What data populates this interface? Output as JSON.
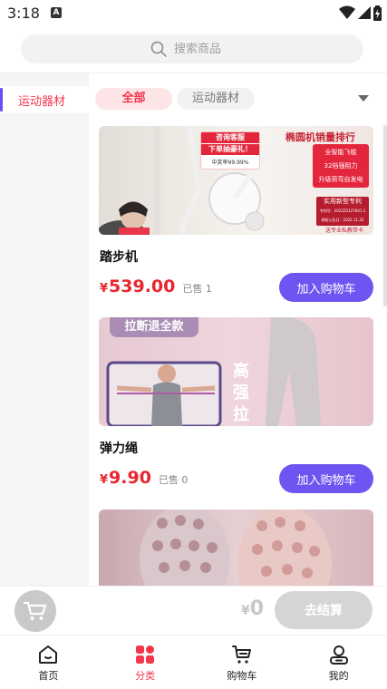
{
  "status_bar": {
    "time": "3:18",
    "notification": "A"
  },
  "search": {
    "placeholder": "搜索商品"
  },
  "sidebar": {
    "items": [
      {
        "label": "运动器材"
      }
    ]
  },
  "filters": {
    "chips": [
      {
        "label": "全部"
      },
      {
        "label": "运动器材"
      }
    ]
  },
  "products": [
    {
      "name": "踏步机",
      "currency": "¥",
      "price": "539.00",
      "sold": "已售 1",
      "button": "加入购物车",
      "image_text": {
        "badge1": "咨询客服",
        "badge2": "下单抽豪礼！",
        "rate": "中奖率99.99%",
        "title": "椭圆机销量排行",
        "b1": "全智能飞梭",
        "b2": "32档强阻力",
        "b3": "升级荷弯自发电",
        "patent": "实用新型专利",
        "p1": "专利号：2022Z2127841.1",
        "p2": "授权公告日：2022.11.25",
        "foot": "送专业私教带卡"
      }
    },
    {
      "name": "弹力绳",
      "currency": "¥",
      "price": "9.90",
      "sold": "已售 0",
      "button": "加入购物车",
      "image_text": {
        "badge": "拉断退全款",
        "vertical": "高强拉"
      }
    },
    {
      "name": "",
      "image_text": {}
    }
  ],
  "checkout": {
    "currency": "¥",
    "total": "0",
    "button": "去结算"
  },
  "tabbar": {
    "items": [
      {
        "label": "首页",
        "icon": "home-icon"
      },
      {
        "label": "分类",
        "icon": "category-icon",
        "active": true
      },
      {
        "label": "购物车",
        "icon": "cart-icon"
      },
      {
        "label": "我的",
        "icon": "profile-icon"
      }
    ]
  },
  "colors": {
    "accent": "#6c55f0",
    "primary_red": "#f4364c",
    "price_red": "#e8262f"
  }
}
